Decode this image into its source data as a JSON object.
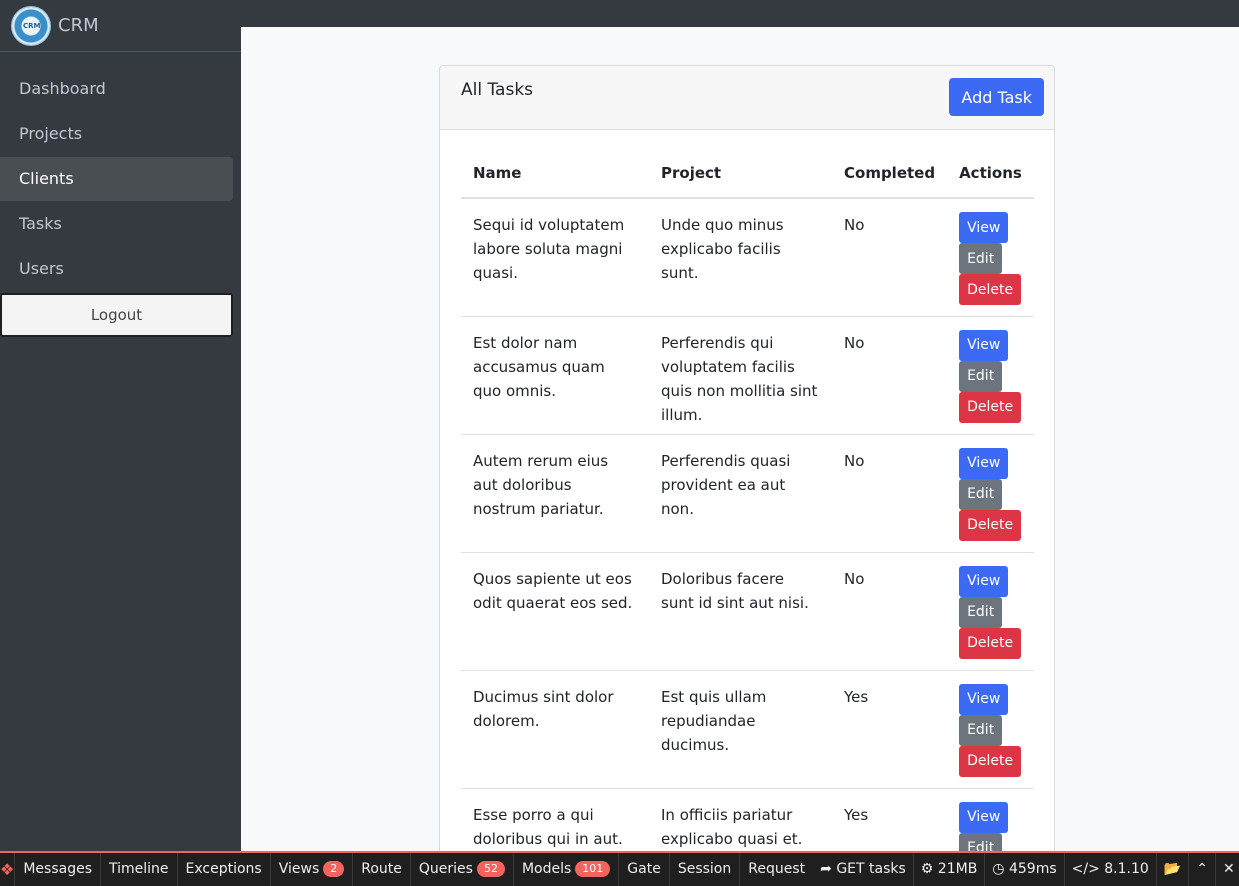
{
  "brand": {
    "name": "CRM",
    "logo_text": "CRM"
  },
  "sidebar": {
    "items": [
      {
        "label": "Dashboard"
      },
      {
        "label": "Projects"
      },
      {
        "label": "Clients"
      },
      {
        "label": "Tasks"
      },
      {
        "label": "Users"
      }
    ],
    "active_index": 2,
    "logout_label": "Logout"
  },
  "card": {
    "title": "All Tasks",
    "add_label": "Add Task"
  },
  "table": {
    "headers": [
      "Name",
      "Project",
      "Completed",
      "Actions"
    ],
    "rows": [
      {
        "name": "Sequi id voluptatem labore soluta magni quasi.",
        "project": "Unde quo minus explicabo facilis sunt.",
        "completed": "No"
      },
      {
        "name": "Est dolor nam accusamus quam quo omnis.",
        "project": "Perferendis qui voluptatem facilis quis non mollitia sint illum.",
        "completed": "No"
      },
      {
        "name": "Autem rerum eius aut doloribus nostrum pariatur.",
        "project": "Perferendis quasi provident ea aut non.",
        "completed": "No"
      },
      {
        "name": "Quos sapiente ut eos odit quaerat eos sed.",
        "project": "Doloribus facere sunt id sint aut nisi.",
        "completed": "No"
      },
      {
        "name": "Ducimus sint dolor dolorem.",
        "project": "Est quis ullam repudiandae ducimus.",
        "completed": "Yes"
      },
      {
        "name": "Esse porro a qui doloribus qui in aut.",
        "project": "In officiis pariatur explicabo quasi et.",
        "completed": "Yes"
      }
    ],
    "actions": {
      "view": "View",
      "edit": "Edit",
      "delete": "Delete"
    }
  },
  "debugbar": {
    "items": [
      {
        "label": "Messages"
      },
      {
        "label": "Timeline"
      },
      {
        "label": "Exceptions"
      },
      {
        "label": "Views",
        "badge": "2"
      },
      {
        "label": "Route"
      },
      {
        "label": "Queries",
        "badge": "52"
      },
      {
        "label": "Models",
        "badge": "101"
      },
      {
        "label": "Gate"
      },
      {
        "label": "Session"
      },
      {
        "label": "Request"
      }
    ],
    "request": "GET tasks",
    "memory": "21MB",
    "time": "459ms",
    "version": "8.1.10",
    "colors": {
      "accent": "#f4645f"
    }
  }
}
